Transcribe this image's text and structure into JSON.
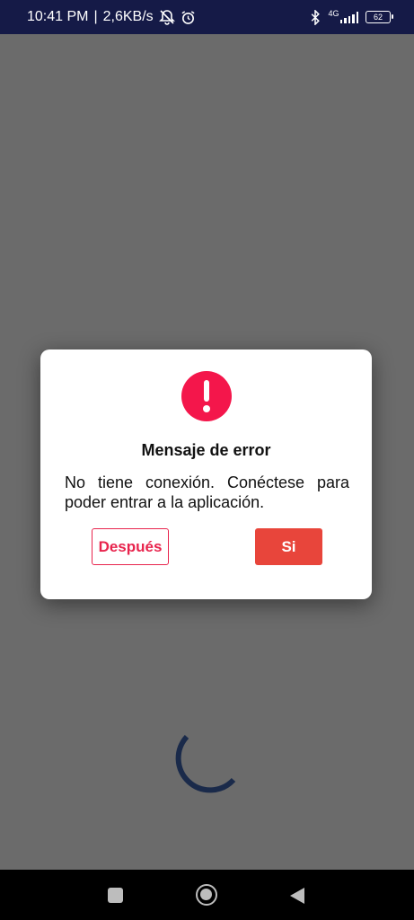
{
  "status_bar": {
    "time": "10:41 PM",
    "separator": "|",
    "speed": "2,6KB/s",
    "network": "4G",
    "battery": "62"
  },
  "dialog": {
    "title": "Mensaje de error",
    "message": "No tiene conexión. Conéctese para poder entrar a la aplicación.",
    "later_label": "Después",
    "yes_label": "Si",
    "icon": "error-exclamation-icon",
    "accent_color": "#e8244d"
  },
  "nav": {
    "recent_icon": "square-icon",
    "home_icon": "circle-icon",
    "back_icon": "triangle-back-icon"
  },
  "colors": {
    "status_bar": "#151a47",
    "overlay": "#6b6b6b",
    "yes_button": "#e8453b",
    "spinner": "#1a2a4a"
  }
}
